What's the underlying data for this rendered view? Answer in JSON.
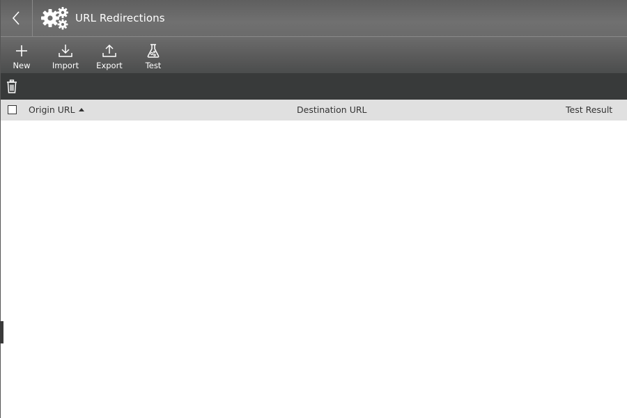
{
  "header": {
    "title": "URL Redirections",
    "back_icon": "chevron-left-icon",
    "app_icon": "gears-icon"
  },
  "toolbar": {
    "items": [
      {
        "label": "New",
        "icon": "plus-icon"
      },
      {
        "label": "Import",
        "icon": "download-icon"
      },
      {
        "label": "Export",
        "icon": "upload-icon"
      },
      {
        "label": "Test",
        "icon": "flask-icon"
      }
    ]
  },
  "actionbar": {
    "delete_icon": "trash-icon"
  },
  "table": {
    "columns": [
      {
        "label": "Origin URL",
        "sorted": "ascending"
      },
      {
        "label": "Destination URL"
      },
      {
        "label": "Test Result"
      }
    ],
    "rows": []
  },
  "colors": {
    "header_bg": "#6b6b6b",
    "toolbar_bg": "#5a5a5a",
    "actionbar_bg": "#383a3a",
    "table_header_bg": "#e0e0e0",
    "text_light": "#ffffff",
    "text_dark": "#333333"
  }
}
